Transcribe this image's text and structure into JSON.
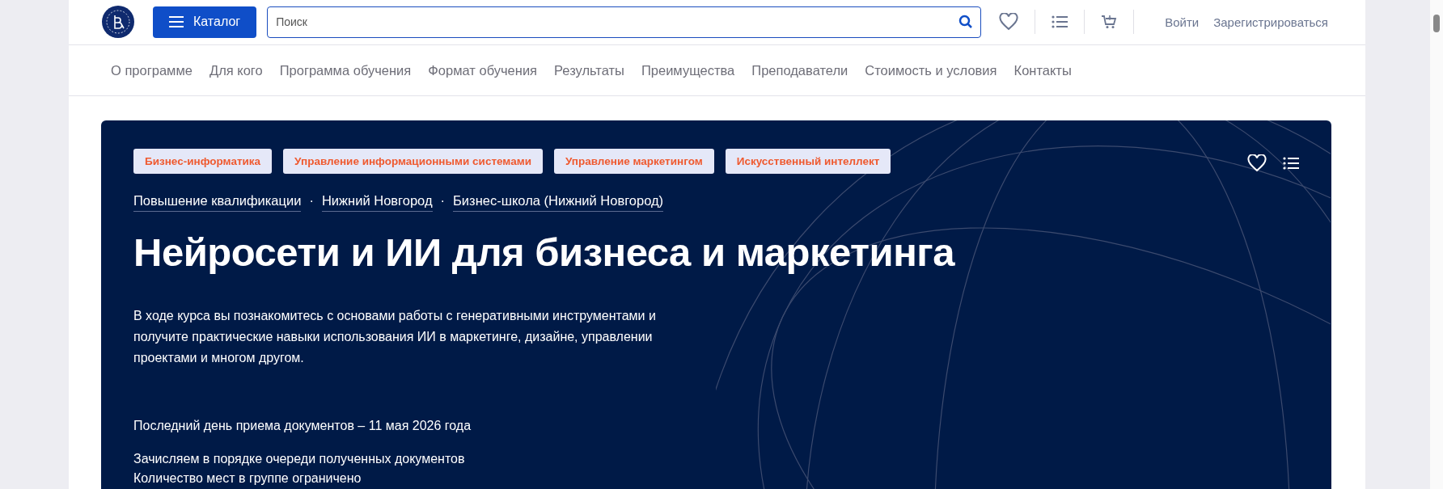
{
  "header": {
    "catalog_button": "Каталог",
    "search": {
      "placeholder": "Поиск"
    },
    "login": "Войти",
    "register": "Зарегистрироваться"
  },
  "nav": [
    {
      "label": "О программе"
    },
    {
      "label": "Для кого"
    },
    {
      "label": "Программа обучения"
    },
    {
      "label": "Формат обучения"
    },
    {
      "label": "Результаты"
    },
    {
      "label": "Преимущества"
    },
    {
      "label": "Преподаватели"
    },
    {
      "label": "Стоимость и условия"
    },
    {
      "label": "Контакты"
    }
  ],
  "hero": {
    "tags": [
      "Бизнес-информатика",
      "Управление информационными системами",
      "Управление маркетингом",
      "Искусственный интеллект"
    ],
    "breadcrumbs": [
      {
        "kind": "link",
        "text": "Повышение квалификации"
      },
      {
        "kind": "separator",
        "text": "·"
      },
      {
        "kind": "link",
        "text": "Нижний Новгород"
      },
      {
        "kind": "separator",
        "text": "·"
      },
      {
        "kind": "link",
        "text": "Бизнес-школа (Нижний Новгород)"
      }
    ],
    "title": "Нейросети и ИИ для бизнеса и маркетинга",
    "description": "В ходе курса вы познакомитесь с основами работы с генеративными инструментами и получите практические навыки использования ИИ в маркетинге, дизайне, управлении проектами и многом другом.",
    "deadline": "Последний день приема документов – 11 мая 2026 года",
    "notes": [
      "Зачисляем в порядке очереди полученных документов",
      "Количество мест в группе ограничено"
    ]
  }
}
